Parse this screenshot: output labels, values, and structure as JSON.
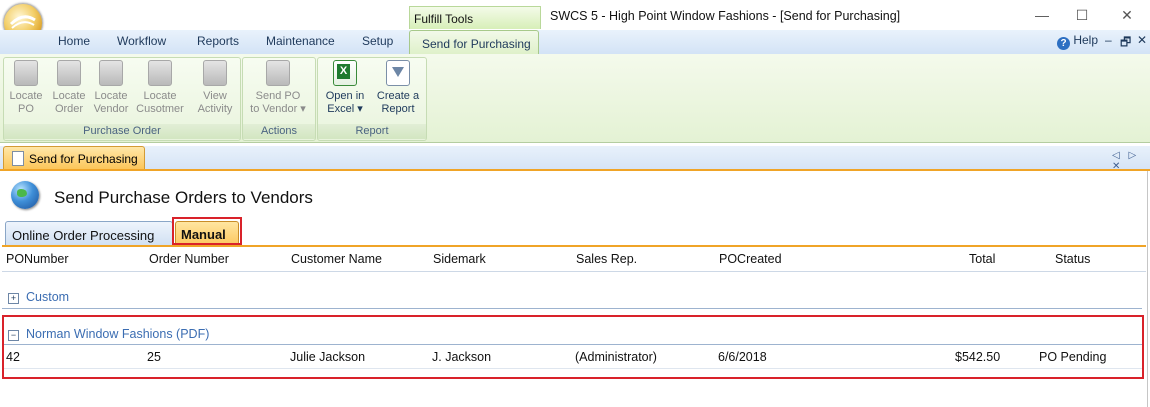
{
  "window": {
    "context_tab": "Fulfill Tools",
    "title": "SWCS 5 - High Point Window Fashions - [Send for Purchasing]",
    "minimize": "—",
    "maximize": "☐",
    "close": "✕"
  },
  "menu": {
    "tabs": [
      "Home",
      "Workflow",
      "Reports",
      "Maintenance",
      "Setup"
    ],
    "active_tab": "Send for Purchasing",
    "help": "Help",
    "help_icon_glyph": "?",
    "mdi_minimize": "–",
    "mdi_restore": "🗗",
    "mdi_close": "✕"
  },
  "ribbon": {
    "groups": {
      "purchase_order": {
        "label": "Purchase Order",
        "buttons": [
          {
            "line1": "Locate",
            "line2": "PO",
            "icon": "locate-po-icon"
          },
          {
            "line1": "Locate",
            "line2": "Order",
            "icon": "locate-order-icon"
          },
          {
            "line1": "Locate",
            "line2": "Vendor",
            "icon": "locate-vendor-icon"
          },
          {
            "line1": "Locate",
            "line2": "Cusotmer",
            "icon": "locate-customer-icon"
          },
          {
            "line1": "View",
            "line2": "Activity",
            "icon": "view-activity-icon"
          }
        ]
      },
      "actions": {
        "label": "Actions",
        "buttons": [
          {
            "line1": "Send PO",
            "line2": "to Vendor ▾",
            "icon": "send-po-icon"
          }
        ]
      },
      "report": {
        "label": "Report",
        "buttons": [
          {
            "line1": "Open in",
            "line2": "Excel ▾",
            "icon": "excel-icon"
          },
          {
            "line1": "Create a",
            "line2": "Report",
            "icon": "report-filter-icon"
          }
        ]
      }
    }
  },
  "document_tab": {
    "label": "Send for Purchasing",
    "nav": "◁ ▷ ✕"
  },
  "page": {
    "title": "Send Purchase Orders to Vendors",
    "subtabs": [
      "Online Order Processing",
      "Manual"
    ],
    "active_subtab": "Manual"
  },
  "grid": {
    "columns": [
      "PONumber",
      "Order Number",
      "Customer Name",
      "Sidemark",
      "Sales Rep.",
      "POCreated",
      "Total",
      "Status"
    ],
    "groups": [
      {
        "name": "Custom",
        "toggle": "+",
        "rows": []
      },
      {
        "name": "Norman Window Fashions (PDF)",
        "toggle": "−",
        "rows": [
          {
            "po_number": "42",
            "order_number": "25",
            "customer_name": "Julie Jackson",
            "sidemark": "J. Jackson",
            "sales_rep": "(Administrator)",
            "po_created": "6/6/2018",
            "total": "$542.50",
            "status": "PO Pending"
          }
        ]
      }
    ]
  },
  "colors": {
    "highlight_red": "#d9222a",
    "active_tab_orange": "#fcc55a",
    "ribbon_green": "#e4f2d4",
    "link_blue": "#3b6db2"
  }
}
